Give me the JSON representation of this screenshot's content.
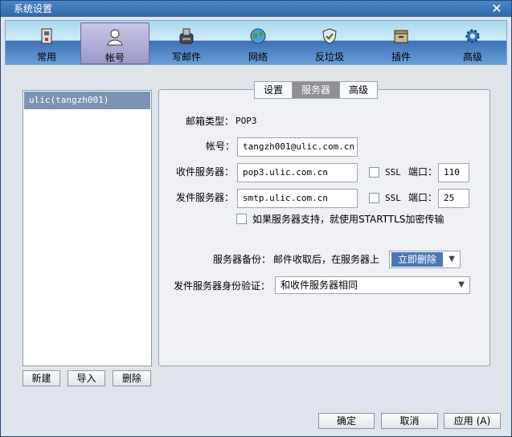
{
  "window": {
    "title": "系统设置"
  },
  "toolbar": {
    "items": [
      {
        "label": "常用",
        "icon": "general-icon"
      },
      {
        "label": "帐号",
        "icon": "account-icon"
      },
      {
        "label": "写邮件",
        "icon": "compose-icon"
      },
      {
        "label": "网络",
        "icon": "network-icon"
      },
      {
        "label": "反垃圾",
        "icon": "antispam-icon"
      },
      {
        "label": "插件",
        "icon": "plugin-icon"
      },
      {
        "label": "高级",
        "icon": "advanced-icon"
      }
    ]
  },
  "accounts": {
    "items": [
      "ulic(tangzh001)"
    ],
    "new_label": "新建",
    "import_label": "导入",
    "delete_label": "删除"
  },
  "tabs": [
    "设置",
    "服务器",
    "高级"
  ],
  "server": {
    "mail_type_label": "邮箱类型：",
    "mail_type_value": "POP3",
    "account_label": "帐号：",
    "account_value": "tangzh001@ulic.com.cn",
    "incoming_label": "收件服务器：",
    "incoming_value": "pop3.ulic.com.cn",
    "outgoing_label": "发件服务器：",
    "outgoing_value": "smtp.ulic.com.cn",
    "ssl_label": "SSL",
    "port_label": "端口：",
    "incoming_port": "110",
    "outgoing_port": "25",
    "starttls_label": "如果服务器支持，就使用STARTTLS加密传输",
    "backup_label": "服务器备份：",
    "backup_desc": "邮件收取后，在服务器上",
    "backup_value": "立即删除",
    "auth_label": "发件服务器身份验证：",
    "auth_value": "和收件服务器相同"
  },
  "footer": {
    "ok_label": "确定",
    "cancel_label": "取消",
    "apply_label": "应用 (A)"
  }
}
